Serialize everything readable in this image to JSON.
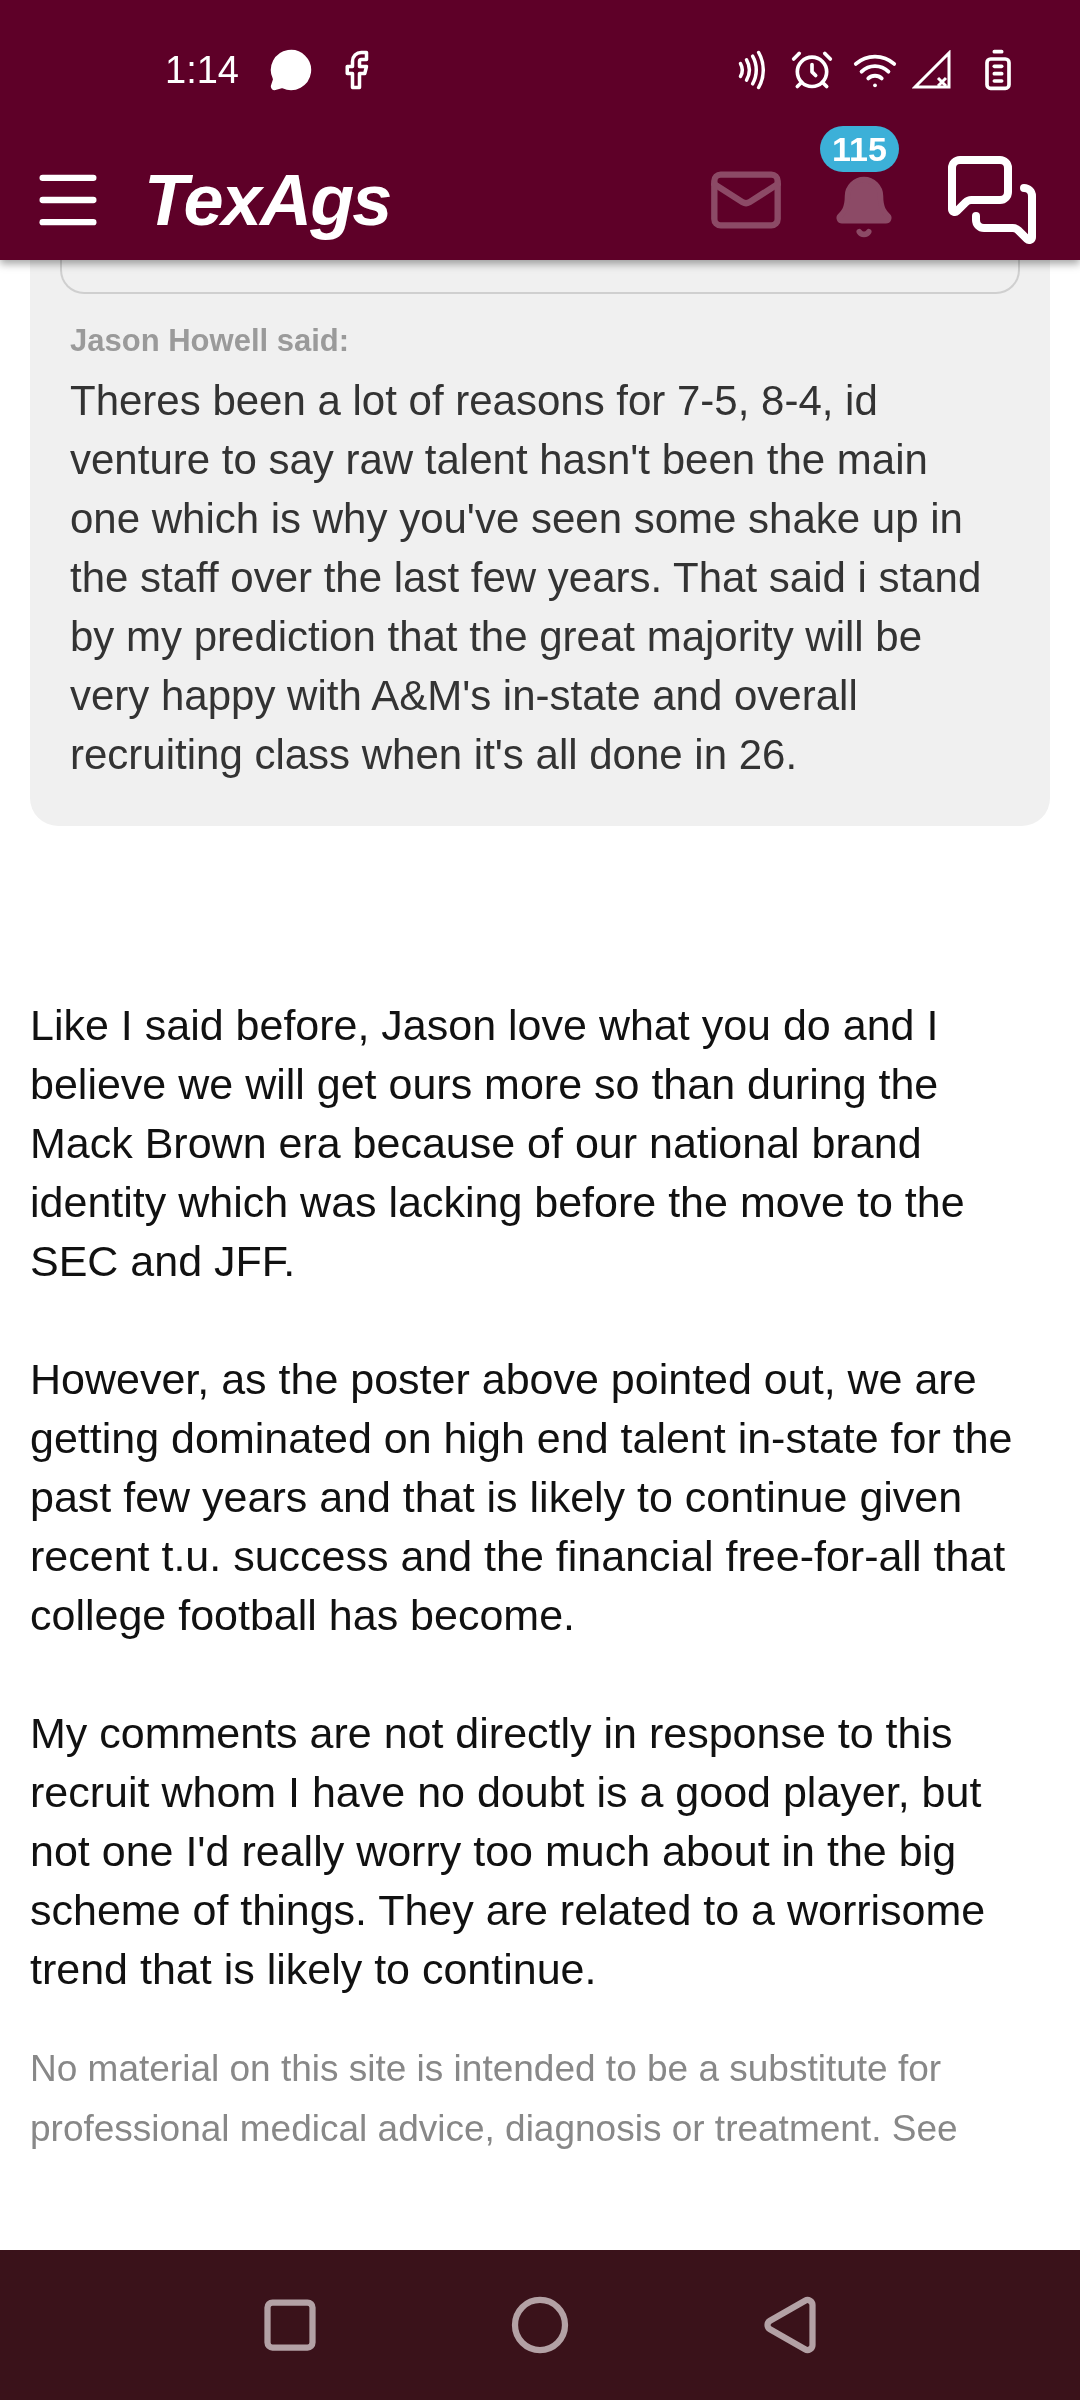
{
  "status_bar": {
    "time": "1:14"
  },
  "header": {
    "logo": "TexAgs",
    "notification_count": "115"
  },
  "quote": {
    "author": "Jason Howell said:",
    "text": "Theres been a lot of reasons for 7-5, 8-4, id venture to say raw talent hasn't been the main one which is why you've seen some shake up in the staff over the last few years. That said i stand by my prediction that the great majority will be very happy with A&M's in-state and overall recruiting class when it's all done in 26."
  },
  "post": {
    "paragraphs": [
      "Like I said before, Jason love what you do and I believe we will get ours more so than during the Mack Brown era because of our national brand identity which was lacking before the move to the SEC and JFF.",
      "However, as the poster above pointed out, we are getting dominated on high end talent in-state for the past few years and that is likely to continue given recent t.u. success and the financial free-for-all that college football has become.",
      "My comments are not directly in response to this recruit whom I have no doubt is a good player, but not one I'd really worry too much about in the big scheme of things. They are related to a worrisome trend that is likely to continue."
    ]
  },
  "footer": {
    "disclaimer": "No material on this site is intended to be a substitute for professional medical advice, diagnosis or treatment. See"
  }
}
